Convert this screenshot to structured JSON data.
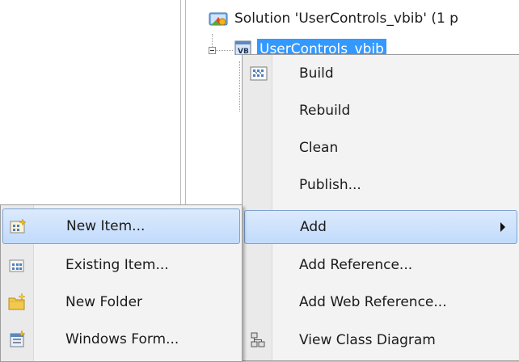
{
  "solution_explorer": {
    "solution_label": "Solution 'UserControls_vbib' (1 p",
    "project_label": "UserControls_vbib"
  },
  "context_menu": {
    "items": [
      {
        "label": "Build",
        "icon": "build-icon"
      },
      {
        "label": "Rebuild"
      },
      {
        "label": "Clean"
      },
      {
        "label": "Publish..."
      },
      {
        "label": "Add",
        "has_submenu": true,
        "highlighted": true
      },
      {
        "label": "Add Reference..."
      },
      {
        "label": "Add Web Reference..."
      },
      {
        "label": "View Class Diagram",
        "icon": "class-diagram-icon"
      }
    ]
  },
  "add_submenu": {
    "items": [
      {
        "label": "New Item...",
        "icon": "new-item-icon",
        "highlighted": true
      },
      {
        "label": "Existing Item...",
        "icon": "existing-item-icon"
      },
      {
        "label": "New Folder",
        "icon": "new-folder-icon"
      },
      {
        "label": "Windows Form...",
        "icon": "windows-form-icon"
      }
    ]
  },
  "colors": {
    "selection": "#3399ff",
    "menu_background": "#f3f3f3",
    "hover_border": "#7da2ce"
  }
}
